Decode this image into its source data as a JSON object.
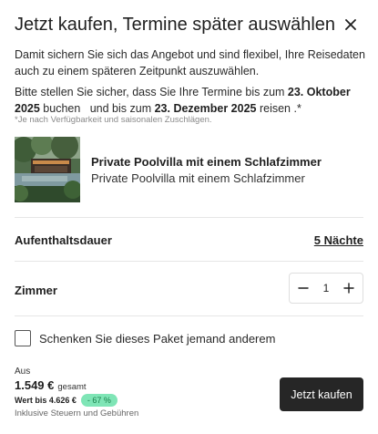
{
  "modal": {
    "title": "Jetzt kaufen, Termine später auswählen",
    "close_icon": "close-icon",
    "description": "Damit sichern Sie sich das Angebot und sind flexibel, Ihre Reisedaten auch zu einem späteren Zeitpunkt auszuwählen.",
    "dates": {
      "part1": "Bitte stellen Sie sicher, dass Sie Ihre Termine bis zum ",
      "booking_deadline": "23. Oktober 2025",
      "part2": " buchen   und bis zum ",
      "travel_deadline": "23. Dezember 2025",
      "part3": " reisen .*"
    },
    "note": "*Je nach Verfügbarkeit und saisonalen Zuschlägen."
  },
  "product": {
    "name": "Private Poolvilla mit einem Schlafzimmer",
    "subtitle": "Private Poolvilla mit einem Schlafzimmer"
  },
  "stay": {
    "label": "Aufenthaltsdauer",
    "value": "5 Nächte"
  },
  "rooms": {
    "label": "Zimmer",
    "value": "1",
    "minus_icon": "minus-icon",
    "plus_icon": "plus-icon"
  },
  "gift": {
    "label": "Schenken Sie dieses Paket jemand anderem",
    "checked": false
  },
  "pricing": {
    "from_label": "Aus",
    "price": "1.549 €",
    "total_label": "gesamt",
    "worth": "Wert bis 4.626 €",
    "discount": "- 67 %",
    "tax_note": "Inklusive Steuern und Gebühren"
  },
  "cta": {
    "label": "Jetzt kaufen"
  },
  "colors": {
    "primary_button": "#262626",
    "discount_bg": "#7fe5b6",
    "discount_text": "#1a7f4b"
  }
}
